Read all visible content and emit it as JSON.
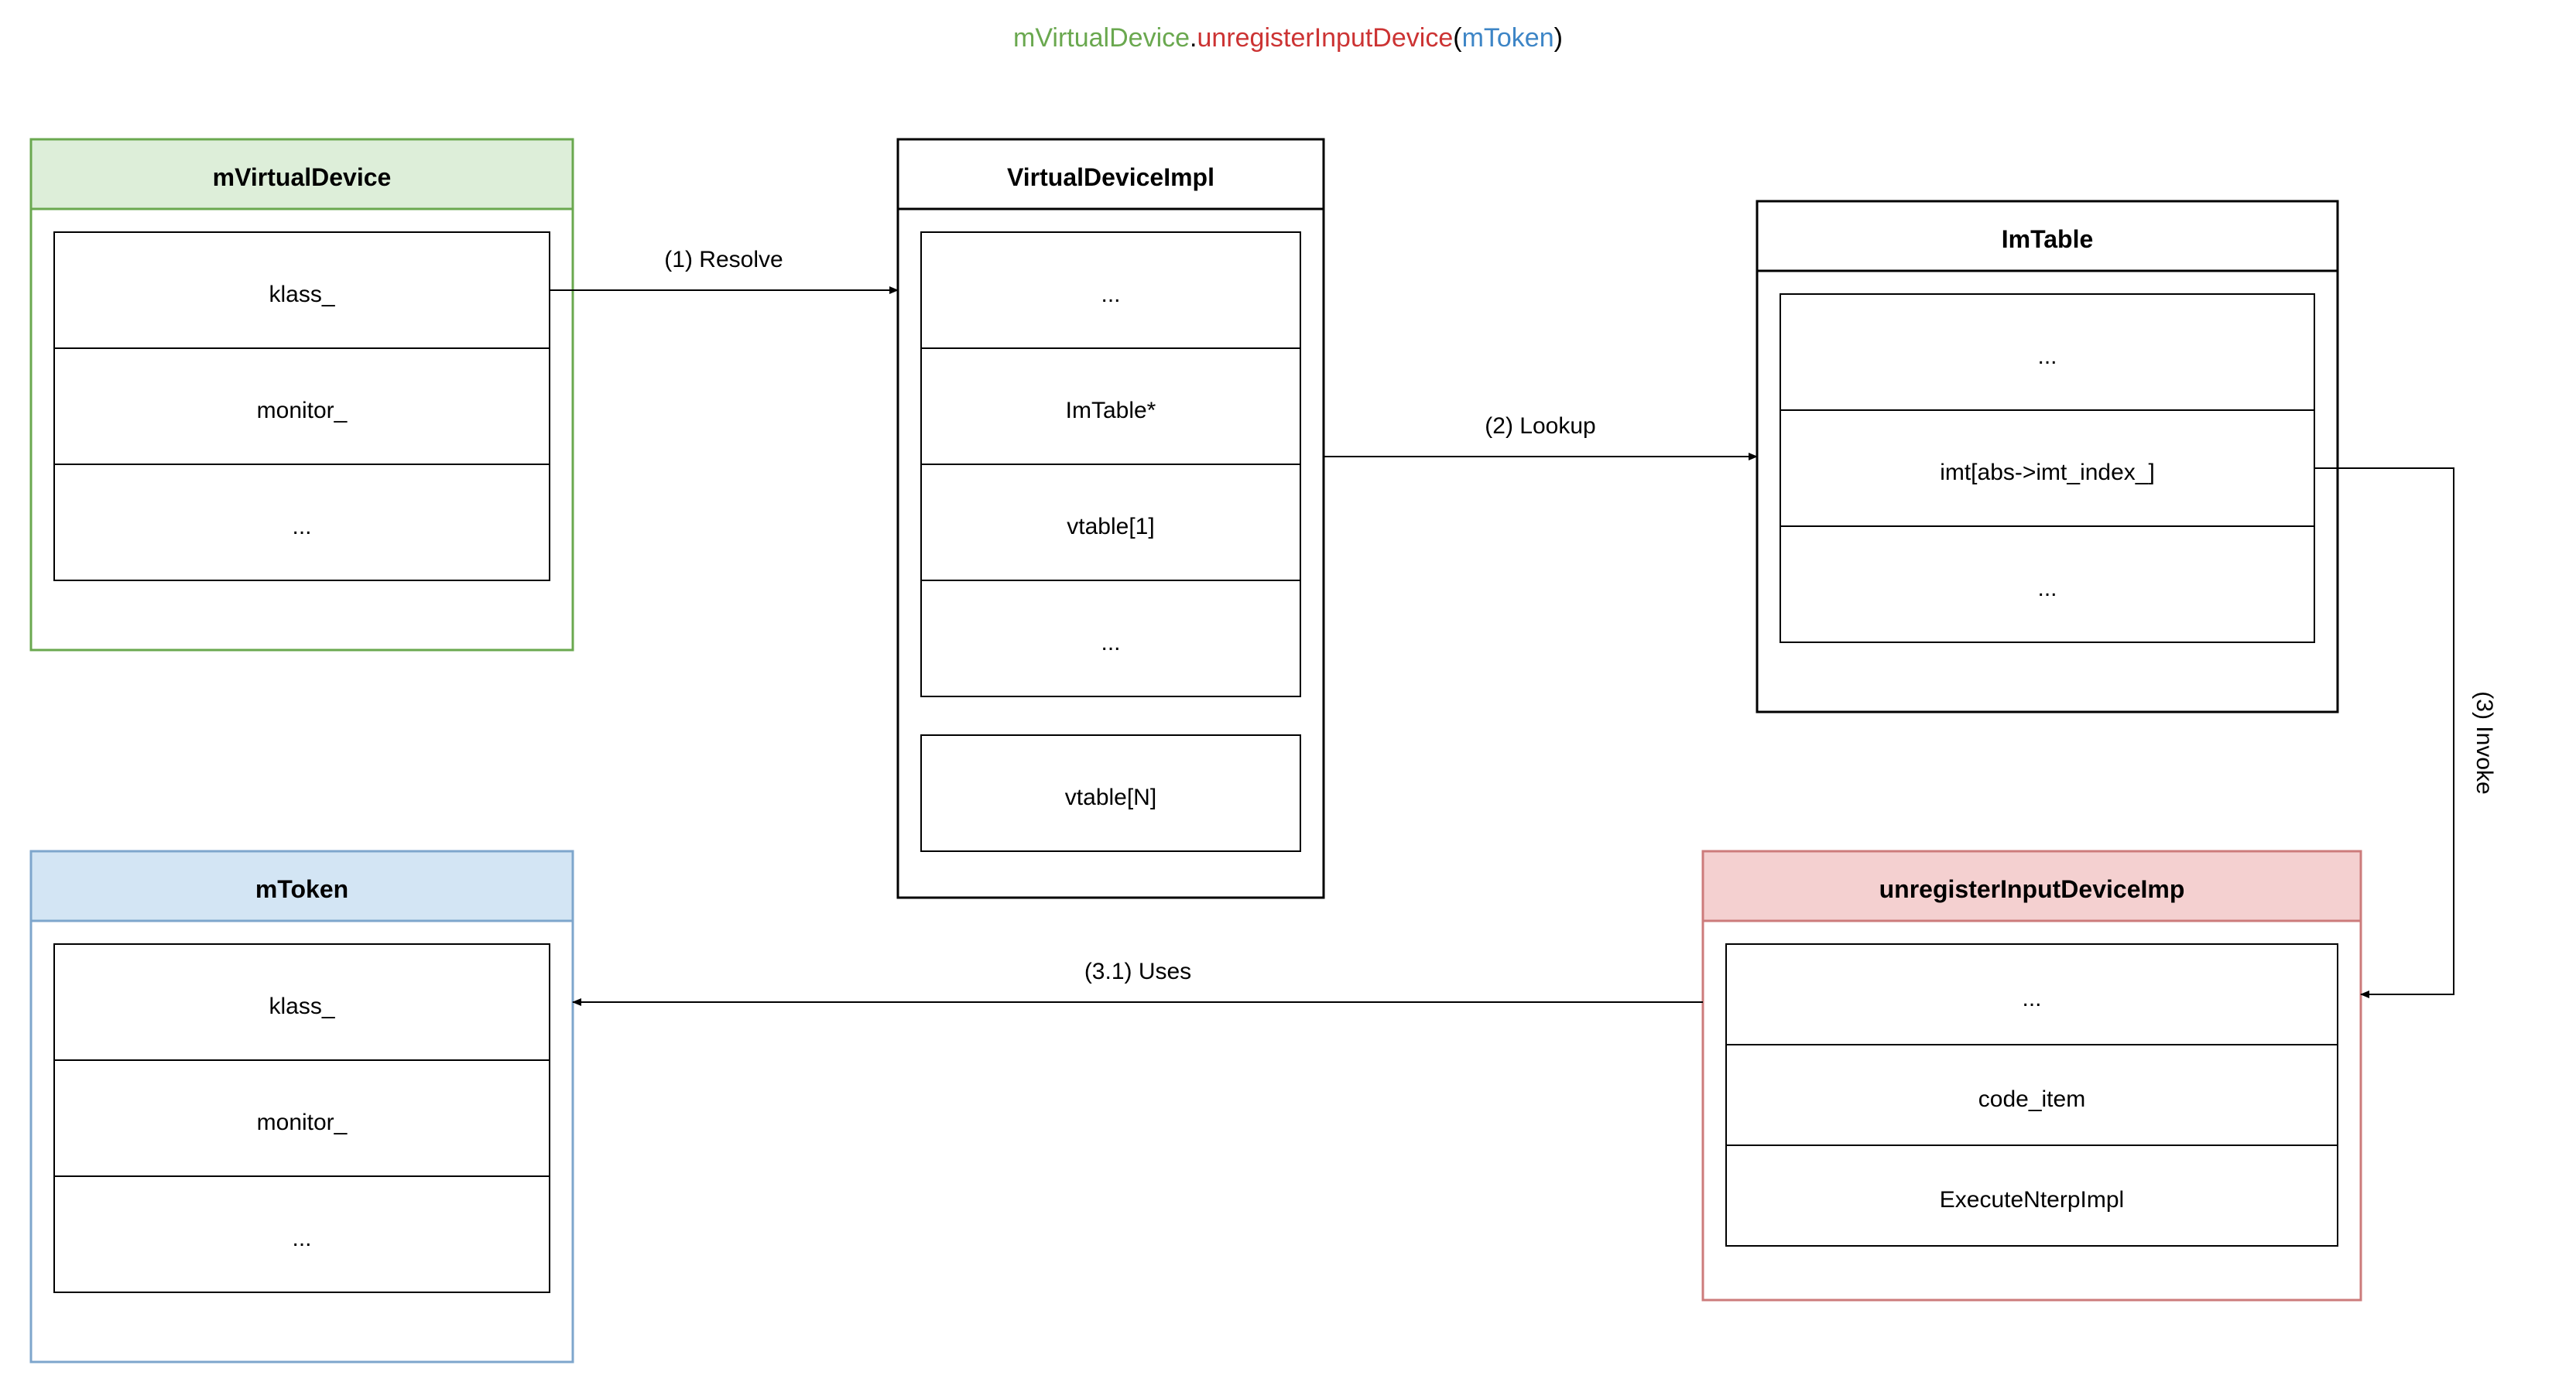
{
  "header": {
    "part1": "mVirtualDevice",
    "dot": ".",
    "part2": "unregisterInputDevice",
    "openParen": "(",
    "part3": "mToken",
    "closeParen": ")"
  },
  "boxes": {
    "mVirtualDevice": {
      "title": "mVirtualDevice",
      "rows": [
        "klass_",
        "monitor_",
        "..."
      ]
    },
    "virtualDeviceImpl": {
      "title": "VirtualDeviceImpl",
      "rows": [
        "...",
        "ImTable*",
        "vtable[1]",
        "...",
        "vtable[N]"
      ]
    },
    "imTable": {
      "title": "ImTable",
      "rows": [
        "...",
        "imt[abs->imt_index_]",
        "..."
      ]
    },
    "mToken": {
      "title": "mToken",
      "rows": [
        "klass_",
        "monitor_",
        "..."
      ]
    },
    "unregisterImpl": {
      "title": "unregisterInputDeviceImp",
      "rows": [
        "...",
        "code_item",
        "ExecuteNterpImpl"
      ]
    }
  },
  "edges": {
    "resolve": "(1) Resolve",
    "lookup": "(2) Lookup",
    "invoke": "(3) Invoke",
    "uses": "(3.1) Uses"
  },
  "colors": {
    "green_fill": "#ddeed9",
    "green_stroke": "#6aa84f",
    "blue_fill": "#d3e5f4",
    "blue_stroke": "#7ea6cc",
    "red_fill": "#f4d0d0",
    "red_stroke": "#cc7b7b",
    "black": "#000000",
    "header_green": "#6aa84f",
    "header_red": "#cc3333",
    "header_blue": "#3d85c6"
  }
}
